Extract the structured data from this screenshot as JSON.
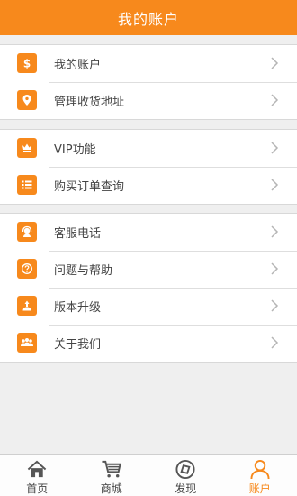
{
  "header": {
    "title": "我的账户"
  },
  "groups": [
    {
      "items": [
        {
          "icon": "dollar-icon",
          "label": "我的账户"
        },
        {
          "icon": "location-pin-icon",
          "label": "管理收货地址"
        }
      ]
    },
    {
      "items": [
        {
          "icon": "vip-crown-icon",
          "label": "VIP功能"
        },
        {
          "icon": "list-icon",
          "label": "购买订单查询"
        }
      ]
    },
    {
      "items": [
        {
          "icon": "headset-icon",
          "label": "客服电话"
        },
        {
          "icon": "help-icon",
          "label": "问题与帮助"
        },
        {
          "icon": "upgrade-icon",
          "label": "版本升级"
        },
        {
          "icon": "team-icon",
          "label": "关于我们"
        }
      ]
    }
  ],
  "tabbar": {
    "items": [
      {
        "icon": "home-icon",
        "label": "首页"
      },
      {
        "icon": "cart-icon",
        "label": "商城"
      },
      {
        "icon": "compass-icon",
        "label": "发现"
      },
      {
        "icon": "user-icon",
        "label": "账户"
      }
    ],
    "active": "账户"
  },
  "colors": {
    "accent": "#f7891c",
    "background": "#efefef",
    "text": "#444444"
  }
}
